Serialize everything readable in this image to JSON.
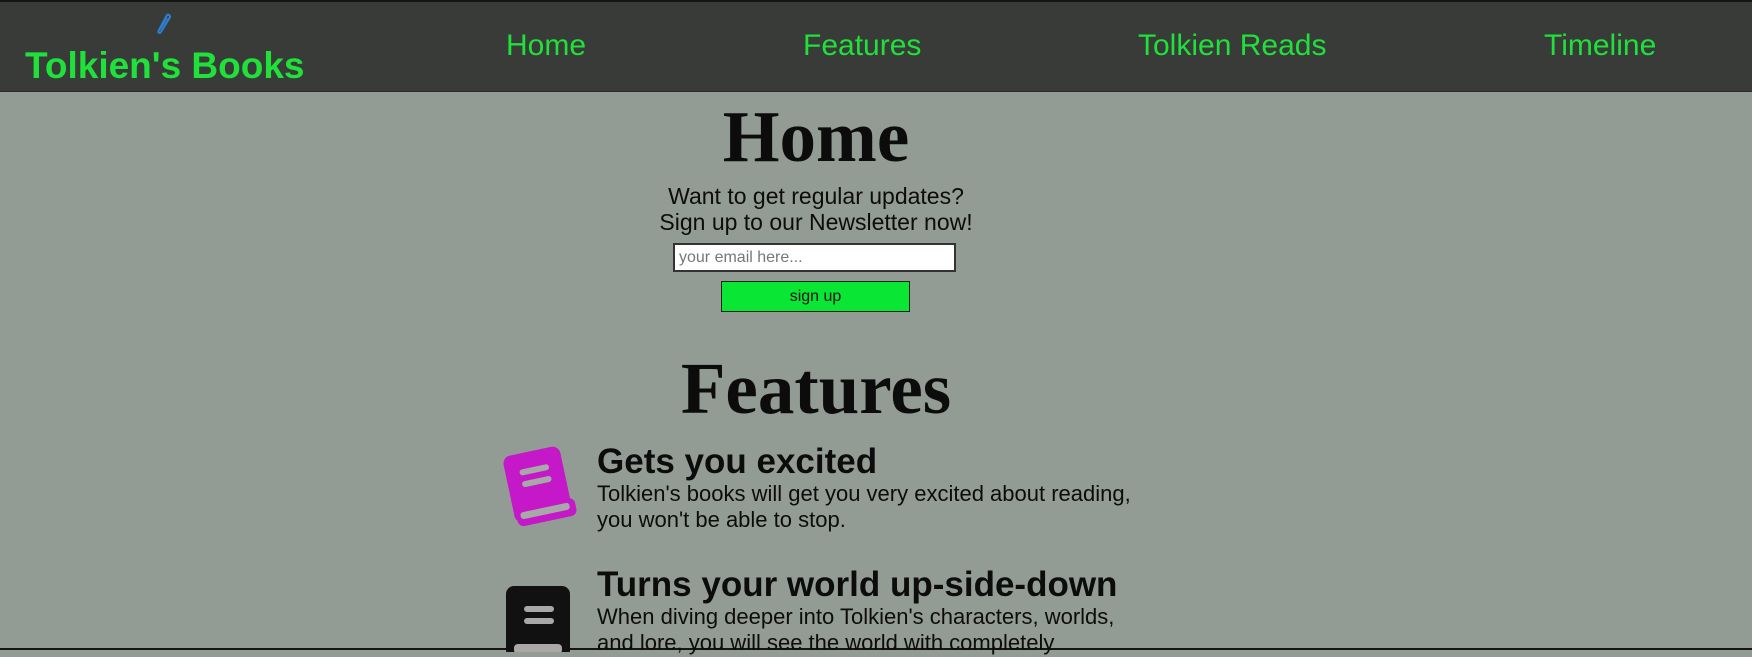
{
  "header": {
    "logo_text": "Tolkien's Books",
    "logo_icon": "feather-pen-icon",
    "nav": [
      {
        "label": "Home"
      },
      {
        "label": "Features"
      },
      {
        "label": "Tolkien Reads"
      },
      {
        "label": "Timeline"
      }
    ]
  },
  "home": {
    "title": "Home",
    "newsletter_line1": "Want to get regular updates?",
    "newsletter_line2": "Sign up to our Newsletter now!",
    "email_placeholder": "your email here...",
    "signup_label": "sign up"
  },
  "features": {
    "title": "Features",
    "items": [
      {
        "icon": "book-icon",
        "icon_color": "#c518c9",
        "heading": "Gets you excited",
        "text": "Tolkien's books will get you very excited about reading, you won't be able to stop."
      },
      {
        "icon": "book-icon",
        "icon_color": "#111111",
        "heading": "Turns your world up-side-down",
        "text": "When diving deeper into Tolkien's characters, worlds, and lore, you will see the world with completely"
      }
    ]
  },
  "colors": {
    "page_background": "#939c94",
    "header_background": "#393b39",
    "accent_green": "#1fe13a",
    "button_green": "#0ae634"
  }
}
